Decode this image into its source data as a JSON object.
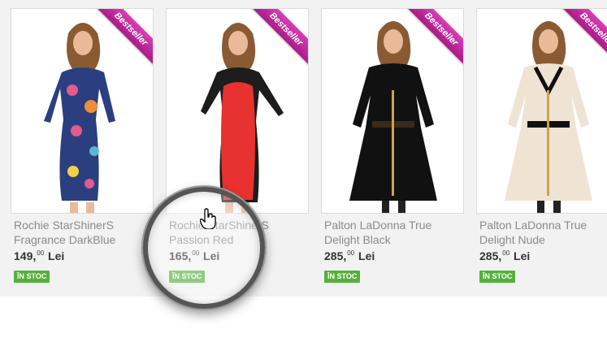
{
  "products": [
    {
      "name_line1": "Rochie StarShinerS",
      "name_line2": "Fragrance DarkBlue",
      "price_int": "149,",
      "price_dec": "00",
      "currency": "Lei",
      "stock": "ÎN STOC",
      "badge": "Bestseller"
    },
    {
      "name_line1": "Rochie StarShinerS",
      "name_line2": "Passion Red",
      "price_int": "165,",
      "price_dec": "00",
      "currency": "Lei",
      "stock": "ÎN STOC",
      "badge": "Bestseller"
    },
    {
      "name_line1": "Palton LaDonna True",
      "name_line2": "Delight Black",
      "price_int": "285,",
      "price_dec": "00",
      "currency": "Lei",
      "stock": "ÎN STOC",
      "badge": "Bestseller"
    },
    {
      "name_line1": "Palton LaDonna True",
      "name_line2": "Delight Nude",
      "price_int": "285,",
      "price_dec": "00",
      "currency": "Lei",
      "stock": "ÎN STOC",
      "badge": "Bestseller"
    }
  ],
  "colors": {
    "badge": "#b3228f",
    "stock": "#55b03c"
  },
  "icons": {
    "cursor": "hand-pointer-icon",
    "magnifier": "magnifier-lens"
  }
}
